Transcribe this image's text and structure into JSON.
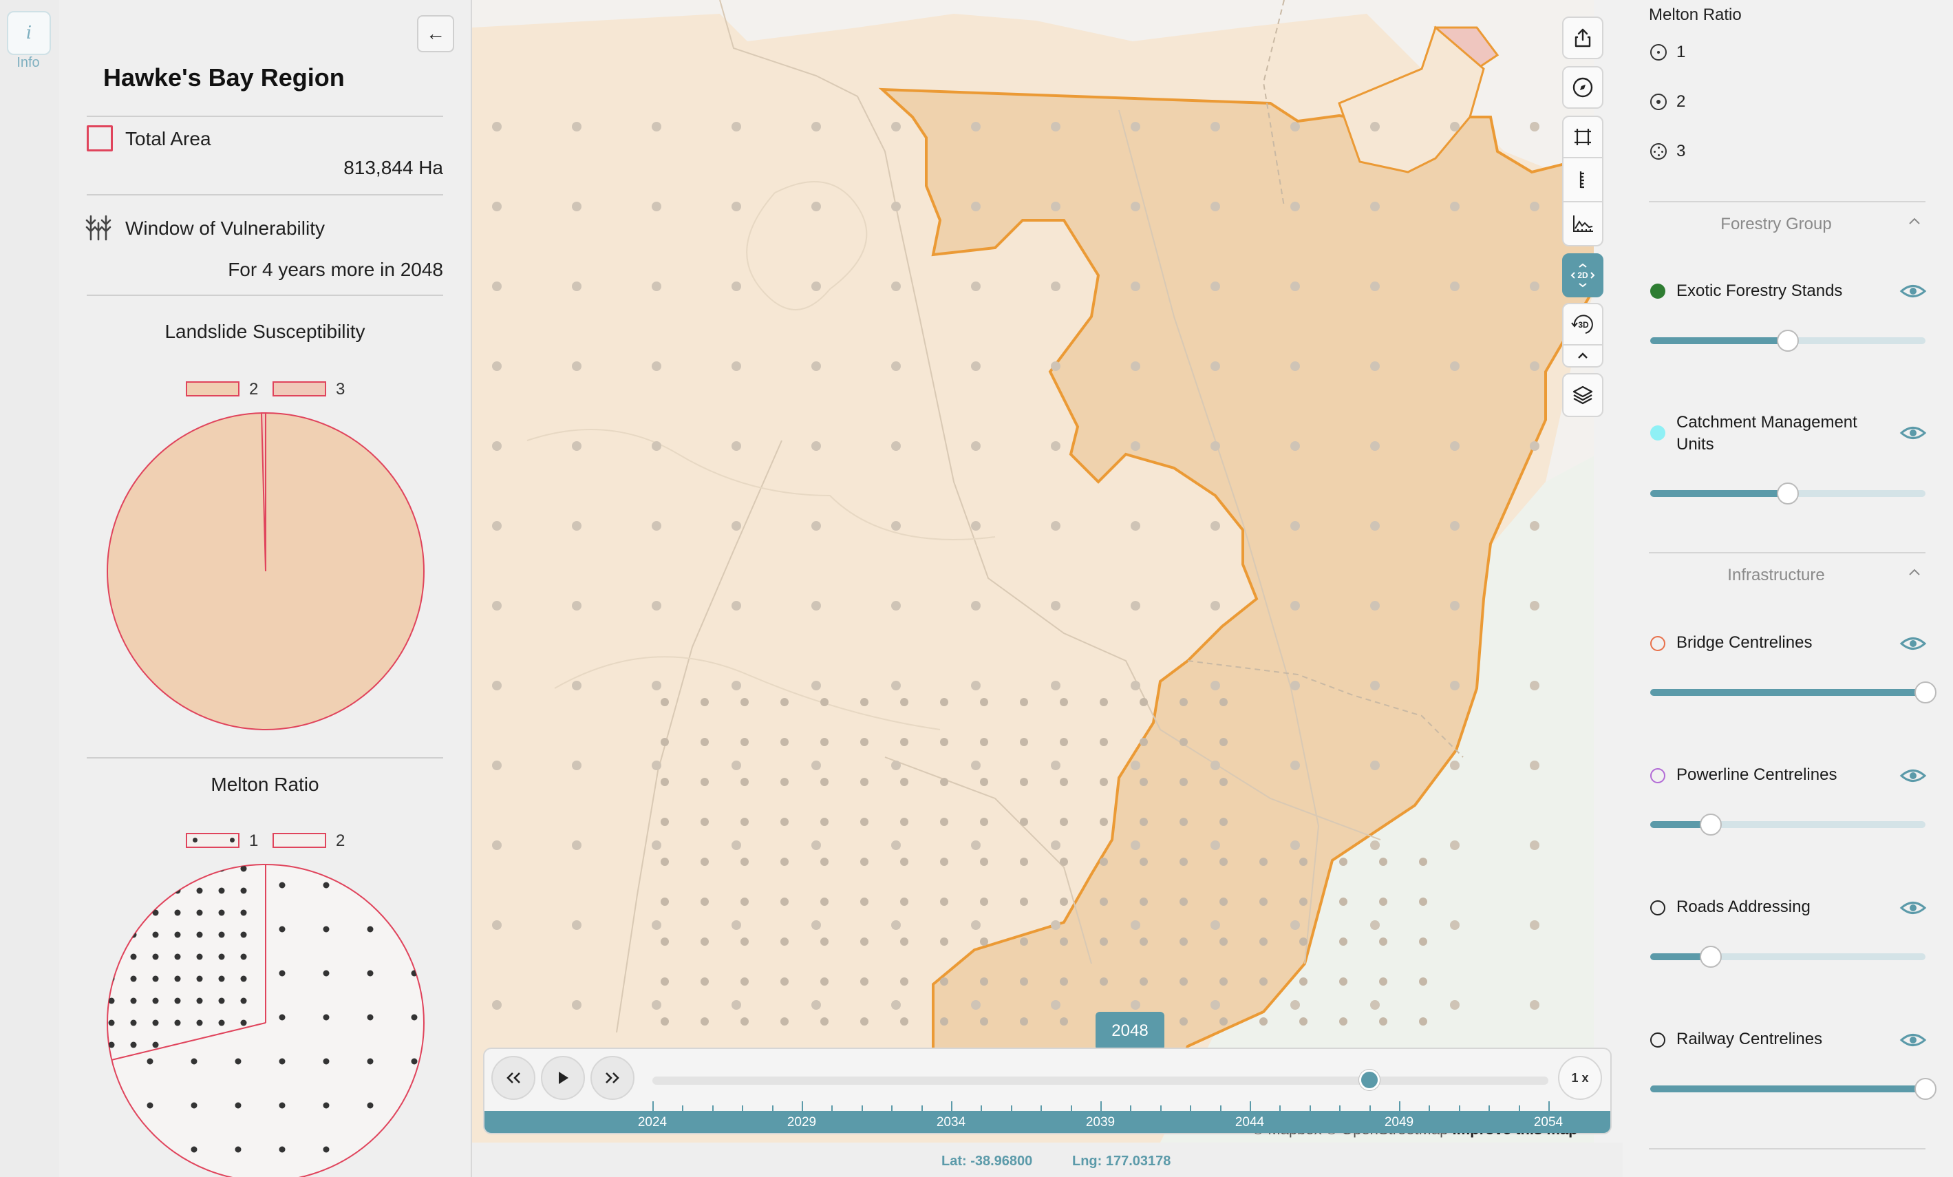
{
  "rail": {
    "info_icon": "i",
    "info_label": "Info"
  },
  "panel": {
    "back_icon": "←",
    "region_title": "Hawke's Bay Region",
    "total_area": {
      "label": "Total Area",
      "value": "813,844 Ha"
    },
    "vulnerability": {
      "label": "Window of Vulnerability",
      "value": "For 4 years more in 2048"
    },
    "landslide": {
      "title": "Landslide Susceptibility",
      "legend": [
        "2",
        "3"
      ]
    },
    "melton": {
      "title": "Melton Ratio",
      "legend": [
        "1",
        "2"
      ]
    }
  },
  "map": {
    "controls": [
      "share-icon",
      "compass-icon",
      "crop-icon",
      "ruler-icon",
      "profile-icon",
      "2d-3d-toggle-icon",
      "rotate-3d-icon",
      "chevron-up-icon",
      "layers-icon"
    ],
    "toggle_2d_label": "2D",
    "toggle_3d_label": "3D"
  },
  "timeline": {
    "current_year": "2048",
    "rewind_icon": "<<",
    "play_icon": "▶",
    "forward_icon": ">>",
    "speed": "1 x",
    "tick_labels": [
      "2024",
      "2029",
      "2034",
      "2039",
      "2044",
      "2049",
      "2054"
    ],
    "progress": 0.8,
    "attribution": "© Mapbox © OpenStreetMap",
    "attribution_link": "Improve this map"
  },
  "coords": {
    "lat": "Lat: -38.96800",
    "lng": "Lng: 177.03178"
  },
  "layers_panel": {
    "melton_title": "Melton Ratio",
    "melton_options": [
      "1",
      "2",
      "3"
    ],
    "groups": [
      {
        "title": "Forestry Group",
        "caret": "^",
        "items": [
          {
            "name": "Exotic Forestry Stands",
            "dot_color": "#2e7d32",
            "opacity": 0.5
          },
          {
            "name_line1": "Catchment Management",
            "name_line2": "Units",
            "dot_color": "#8ff0f5",
            "opacity": 0.5
          }
        ]
      },
      {
        "title": "Infrastructure",
        "caret": "^",
        "items": [
          {
            "name": "Bridge Centrelines",
            "dot_color": "#e8704a",
            "opacity": 1.0
          },
          {
            "name": "Powerline Centrelines",
            "dot_color": "#b26bd6",
            "opacity": 0.22
          },
          {
            "name": "Roads Addressing",
            "dot_color": "#222222",
            "opacity": 0.22
          },
          {
            "name": "Railway Centrelines",
            "dot_color": "#222222",
            "opacity": 1.0
          }
        ]
      }
    ]
  },
  "colors": {
    "accent": "#5b9aa9",
    "danger": "#e0445c",
    "area_fill": "#f0d4b8",
    "map_orange": "#f0a040"
  }
}
